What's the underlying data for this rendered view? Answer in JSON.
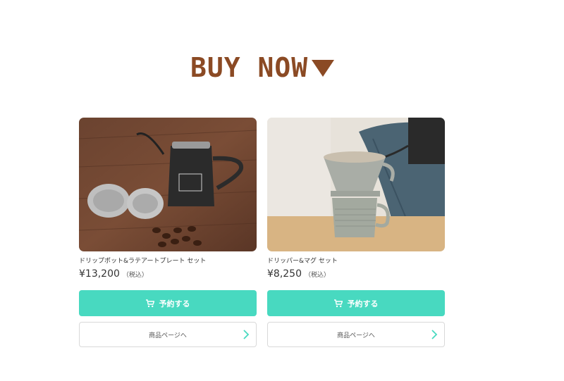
{
  "heading": {
    "text": "BUY NOW",
    "arrow_icon": "down-triangle-icon",
    "color": "#8b4a24"
  },
  "products": [
    {
      "name": "ドリップポット&ラテアートプレート セット",
      "price": "¥13,200",
      "tax_note": "（税込）",
      "reserve_label": "予約する",
      "reserve_icon": "cart-icon",
      "details_label": "商品ページへ",
      "details_icon": "chevron-right-icon"
    },
    {
      "name": "ドリッパー&マグ セット",
      "price": "¥8,250",
      "tax_note": "（税込）",
      "reserve_label": "予約する",
      "reserve_icon": "cart-icon",
      "details_label": "商品ページへ",
      "details_icon": "chevron-right-icon"
    }
  ],
  "colors": {
    "accent": "#48d9c0",
    "heading": "#8b4a24",
    "border": "#d9d9d9"
  }
}
